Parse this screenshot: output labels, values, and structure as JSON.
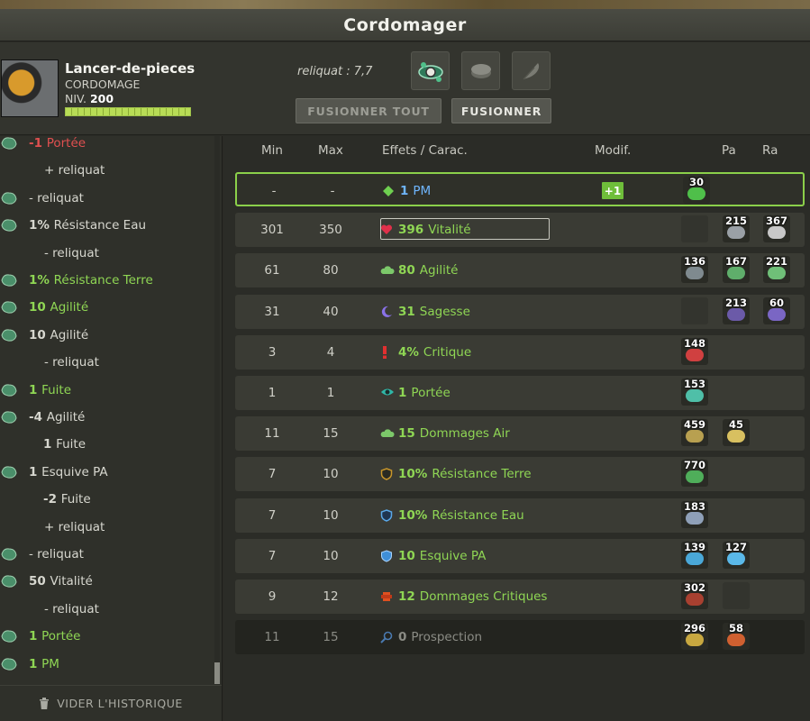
{
  "window": {
    "title": "Cordomager"
  },
  "character": {
    "name": "Lancer-de-pieces",
    "job": "CORDOMAGE",
    "level_label": "NIV.",
    "level": "200",
    "xp_fraction": 1.0
  },
  "reliquat": "reliquat : 7,7",
  "slots": [
    {
      "icon": "cordomage-item-icon",
      "filled": true
    },
    {
      "icon": "rune-slot-icon",
      "filled": false
    },
    {
      "icon": "feather-icon",
      "filled": false
    }
  ],
  "buttons": {
    "fuse_all": "FUSIONNER TOUT",
    "fuse": "FUSIONNER"
  },
  "columns": {
    "min": "Min",
    "max": "Max",
    "effects": "Effets / Carac.",
    "modif": "Modif.",
    "pa": "Pa",
    "ra": "Ra"
  },
  "history": [
    {
      "icon": "rune-icon",
      "value": "-1",
      "label": "Portée",
      "color": "#e05050"
    },
    {
      "icon": "",
      "value": "",
      "label": "+ reliquat",
      "color": "#d7d7cf"
    },
    {
      "icon": "rune-icon",
      "value": "",
      "label": "- reliquat",
      "color": "#d7d7cf"
    },
    {
      "icon": "rune-icon",
      "value": "1%",
      "label": "Résistance Eau",
      "color": "#d7d7cf"
    },
    {
      "icon": "",
      "value": "",
      "label": "- reliquat",
      "color": "#d7d7cf"
    },
    {
      "icon": "rune-icon",
      "value": "1%",
      "label": "Résistance Terre",
      "color": "#8fd654"
    },
    {
      "icon": "rune-icon",
      "value": "10",
      "label": "Agilité",
      "color": "#8fd654"
    },
    {
      "icon": "rune-icon",
      "value": "10",
      "label": "Agilité",
      "color": "#d7d7cf"
    },
    {
      "icon": "",
      "value": "",
      "label": "- reliquat",
      "color": "#d7d7cf"
    },
    {
      "icon": "rune-icon",
      "value": "1",
      "label": "Fuite",
      "color": "#8fd654"
    },
    {
      "icon": "rune-icon",
      "value": "-4",
      "label": "Agilité",
      "color": "#d7d7cf"
    },
    {
      "icon": "",
      "value": "1",
      "label": "Fuite",
      "color": "#d7d7cf"
    },
    {
      "icon": "rune-icon",
      "value": "1",
      "label": "Esquive PA",
      "color": "#d7d7cf"
    },
    {
      "icon": "",
      "value": "-2",
      "label": "Fuite",
      "color": "#d7d7cf"
    },
    {
      "icon": "",
      "value": "",
      "label": "+ reliquat",
      "color": "#d7d7cf"
    },
    {
      "icon": "rune-icon",
      "value": "",
      "label": "- reliquat",
      "color": "#d7d7cf"
    },
    {
      "icon": "rune-icon",
      "value": "50",
      "label": "Vitalité",
      "color": "#d7d7cf"
    },
    {
      "icon": "",
      "value": "",
      "label": "- reliquat",
      "color": "#d7d7cf"
    },
    {
      "icon": "rune-icon",
      "value": "1",
      "label": "Portée",
      "color": "#8fd654"
    },
    {
      "icon": "rune-icon",
      "value": "1",
      "label": "PM",
      "color": "#8fd654"
    }
  ],
  "clear_history": "VIDER L'HISTORIQUE",
  "effects": [
    {
      "min": "-",
      "max": "-",
      "icon": "pm-icon",
      "value": "1",
      "label": "PM",
      "color": "#6fb6ff",
      "modif": "+1",
      "active": true,
      "runes": [
        {
          "col": "ba",
          "num": "30",
          "gem": "#4fbf4a"
        }
      ]
    },
    {
      "min": "301",
      "max": "350",
      "icon": "heart-icon",
      "value": "396",
      "label": "Vitalité",
      "color": "#8fd654",
      "boxed": true,
      "runes": [
        {
          "col": "ba",
          "num": "",
          "gem": ""
        },
        {
          "col": "pa",
          "num": "215",
          "gem": "#9aa0a6"
        },
        {
          "col": "ra",
          "num": "367",
          "gem": "#c8c8c8"
        }
      ]
    },
    {
      "min": "61",
      "max": "80",
      "icon": "cloud-icon",
      "value": "80",
      "label": "Agilité",
      "color": "#8fd654",
      "runes": [
        {
          "col": "ba",
          "num": "136",
          "gem": "#7f8a8f"
        },
        {
          "col": "pa",
          "num": "167",
          "gem": "#5fae6b"
        },
        {
          "col": "ra",
          "num": "221",
          "gem": "#6fbf78"
        }
      ]
    },
    {
      "min": "31",
      "max": "40",
      "icon": "moon-icon",
      "value": "31",
      "label": "Sagesse",
      "color": "#8fd654",
      "runes": [
        {
          "col": "ba",
          "num": "",
          "gem": ""
        },
        {
          "col": "pa",
          "num": "213",
          "gem": "#6b5aa8"
        },
        {
          "col": "ra",
          "num": "60",
          "gem": "#7a66c4"
        }
      ]
    },
    {
      "min": "3",
      "max": "4",
      "icon": "critical-icon",
      "value": "4%",
      "label": "Critique",
      "color": "#8fd654",
      "runes": [
        {
          "col": "ba",
          "num": "148",
          "gem": "#d04040"
        }
      ]
    },
    {
      "min": "1",
      "max": "1",
      "icon": "eye-icon",
      "value": "1",
      "label": "Portée",
      "color": "#8fd654",
      "runes": [
        {
          "col": "ba",
          "num": "153",
          "gem": "#4fbfa8"
        }
      ]
    },
    {
      "min": "11",
      "max": "15",
      "icon": "cloud-icon",
      "value": "15",
      "label": "Dommages Air",
      "color": "#8fd654",
      "runes": [
        {
          "col": "ba",
          "num": "459",
          "gem": "#b8a050"
        },
        {
          "col": "pa",
          "num": "45",
          "gem": "#d8c060"
        }
      ]
    },
    {
      "min": "7",
      "max": "10",
      "icon": "earth-shield-icon",
      "value": "10%",
      "label": "Résistance Terre",
      "color": "#8fd654",
      "runes": [
        {
          "col": "ba",
          "num": "770",
          "gem": "#4fae5a"
        }
      ]
    },
    {
      "min": "7",
      "max": "10",
      "icon": "water-shield-icon",
      "value": "10%",
      "label": "Résistance Eau",
      "color": "#8fd654",
      "runes": [
        {
          "col": "ba",
          "num": "183",
          "gem": "#8fa0b8"
        }
      ]
    },
    {
      "min": "7",
      "max": "10",
      "icon": "shield-icon",
      "value": "10",
      "label": "Esquive PA",
      "color": "#8fd654",
      "runes": [
        {
          "col": "ba",
          "num": "139",
          "gem": "#4aa8d8"
        },
        {
          "col": "pa",
          "num": "127",
          "gem": "#5ab8e8"
        }
      ]
    },
    {
      "min": "9",
      "max": "12",
      "icon": "crit-damage-icon",
      "value": "12",
      "label": "Dommages Critiques",
      "color": "#8fd654",
      "runes": [
        {
          "col": "ba",
          "num": "302",
          "gem": "#a84030"
        },
        {
          "col": "pa",
          "num": "",
          "gem": ""
        }
      ]
    },
    {
      "min": "11",
      "max": "15",
      "icon": "magnifier-icon",
      "value": "0",
      "label": "Prospection",
      "color": "#8b8c85",
      "dim": true,
      "runes": [
        {
          "col": "ba",
          "num": "296",
          "gem": "#c8a840"
        },
        {
          "col": "pa",
          "num": "58",
          "gem": "#d06030"
        }
      ]
    }
  ]
}
